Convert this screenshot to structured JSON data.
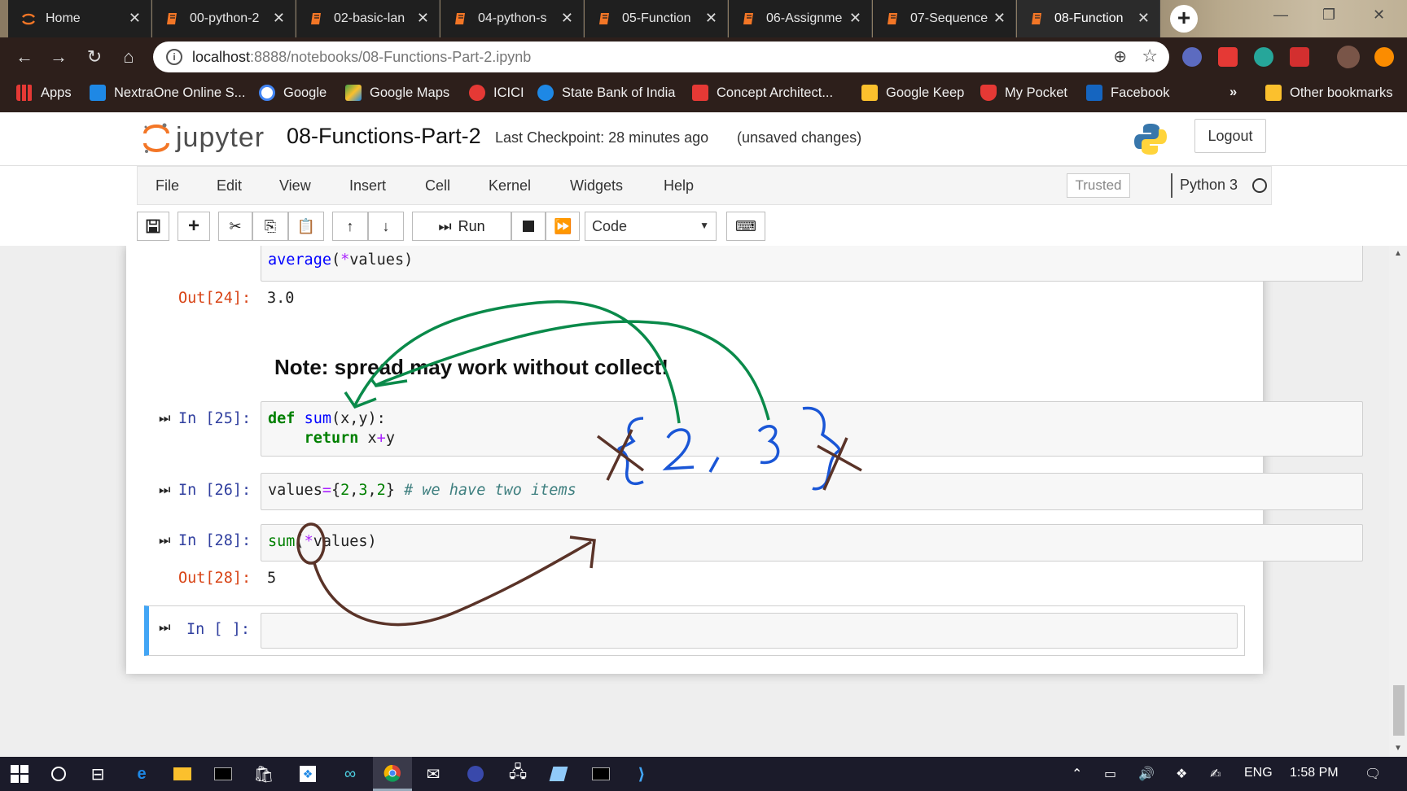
{
  "browser": {
    "tabs": [
      {
        "label": "Home",
        "icon": "jupyter-icon"
      },
      {
        "label": "00-python-2",
        "icon": "notebook-icon"
      },
      {
        "label": "02-basic-lan",
        "icon": "notebook-icon"
      },
      {
        "label": "04-python-s",
        "icon": "notebook-icon"
      },
      {
        "label": "05-Function",
        "icon": "notebook-icon"
      },
      {
        "label": "06-Assignme",
        "icon": "notebook-icon"
      },
      {
        "label": "07-Sequence",
        "icon": "notebook-icon"
      },
      {
        "label": "08-Function",
        "icon": "notebook-icon",
        "active": true
      }
    ],
    "url_host": "localhost",
    "url_path": ":8888/notebooks/08-Functions-Part-2.ipynb",
    "bookmarks": [
      {
        "label": "Apps",
        "color": "#e53935"
      },
      {
        "label": "NextraOne Online S...",
        "color": "#1e88e5"
      },
      {
        "label": "Google",
        "color": "#ffffff"
      },
      {
        "label": "Google Maps",
        "color": "#43a047"
      },
      {
        "label": "ICICI",
        "color": "#e53935"
      },
      {
        "label": "State Bank of India",
        "color": "#1e88e5"
      },
      {
        "label": "Concept Architect...",
        "color": "#e53935"
      },
      {
        "label": "Google Keep",
        "color": "#fbc02d"
      },
      {
        "label": "My Pocket",
        "color": "#e53935"
      },
      {
        "label": "Facebook",
        "color": "#1565c0"
      }
    ],
    "more_bookmarks": "»",
    "other_bookmarks": "Other bookmarks"
  },
  "jupyter": {
    "logo_text": "jupyter",
    "notebook_name": "08-Functions-Part-2",
    "checkpoint": "Last Checkpoint: 28 minutes ago",
    "unsaved": "(unsaved changes)",
    "logout": "Logout",
    "menu": [
      "File",
      "Edit",
      "View",
      "Insert",
      "Cell",
      "Kernel",
      "Widgets",
      "Help"
    ],
    "trusted": "Trusted",
    "kernel": "Python 3",
    "run_label": "Run",
    "cell_type": "Code"
  },
  "cells": {
    "c24_code": "average(*values)",
    "c24_out_prompt": "Out[24]:",
    "c24_out": "3.0",
    "note": "Note: spread may work without collect!",
    "c25_prompt": "In [25]:",
    "c26_prompt": "In [26]:",
    "c26_comment": "# we have two items",
    "c28_prompt": "In [28]:",
    "c28_out_prompt": "Out[28]:",
    "c28_out": "5",
    "empty_prompt": "In [ ]:"
  },
  "annotations": {
    "green_color": "#0a8a4a",
    "blue_color": "#1a56d6",
    "brown_color": "#5a3328"
  },
  "taskbar": {
    "lang": "ENG",
    "time": "1:58 PM"
  }
}
